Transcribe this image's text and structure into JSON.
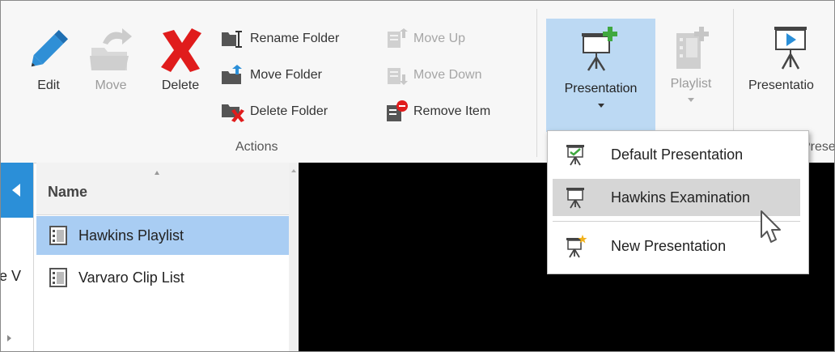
{
  "ribbon": {
    "edit_label": "Edit",
    "move_label": "Move",
    "delete_label": "Delete",
    "rename_folder_label": "Rename Folder",
    "move_folder_label": "Move Folder",
    "delete_folder_label": "Delete Folder",
    "move_up_label": "Move Up",
    "move_down_label": "Move Down",
    "remove_item_label": "Remove Item",
    "actions_group_label": "Actions",
    "presentation_label": "Presentation",
    "playlist_label": "Playlist",
    "presentation_cut_label": "Presentatio",
    "group_cut_label": "Prese"
  },
  "dropdown": {
    "items": [
      {
        "label": "Default Presentation",
        "icon": "presentation-check-icon"
      },
      {
        "label": "Hawkins Examination",
        "icon": "presentation-icon"
      },
      {
        "label": "New Presentation",
        "icon": "new-presentation-icon"
      }
    ]
  },
  "list": {
    "header": "Name",
    "rows": [
      {
        "label": "Hawkins Playlist",
        "selected": true
      },
      {
        "label": "Varvaro Clip List",
        "selected": false
      }
    ]
  },
  "left_strip": {
    "cut_text": "e V"
  },
  "colors": {
    "selection": "#a9cdf3",
    "accent_blue": "#2b8fd8",
    "delete_red": "#e01c1c",
    "edit_blue": "#2f8fd6",
    "preview_bg": "#000000"
  }
}
